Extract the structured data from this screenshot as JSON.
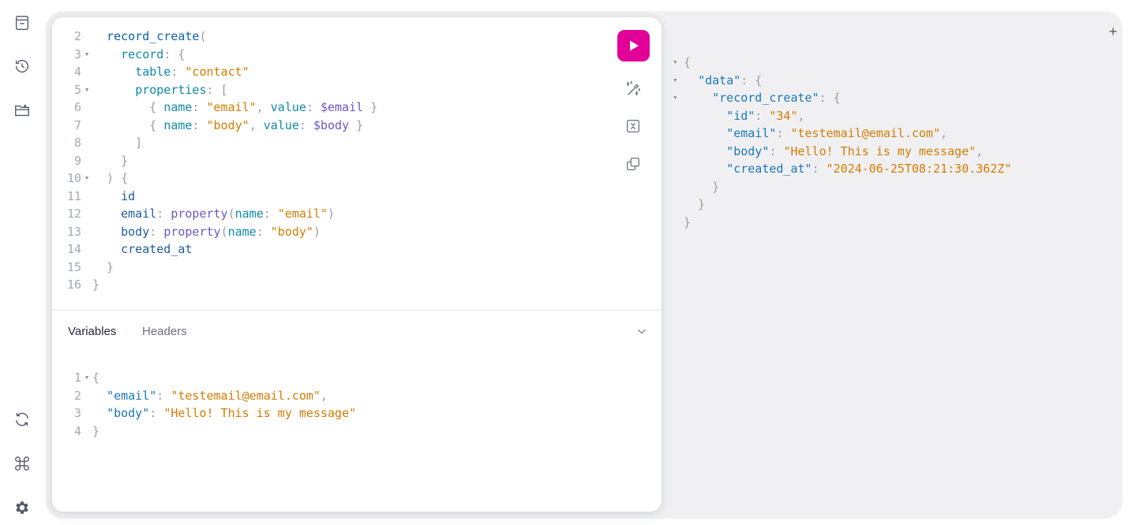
{
  "sidebar": {
    "top_icons": [
      "docs-icon",
      "history-icon",
      "explorer-icon"
    ],
    "bottom_icons": [
      "refetch-icon",
      "shortcuts-icon",
      "settings-icon"
    ]
  },
  "query_editor": {
    "lines": [
      {
        "n": "2",
        "fold": false,
        "t": [
          [
            "  ",
            "p"
          ],
          [
            "record_create",
            "f"
          ],
          [
            "(",
            "p"
          ]
        ]
      },
      {
        "n": "3",
        "fold": true,
        "t": [
          [
            "    ",
            "p"
          ],
          [
            "record",
            "a"
          ],
          [
            ": {",
            "p"
          ]
        ]
      },
      {
        "n": "4",
        "fold": false,
        "t": [
          [
            "      ",
            "p"
          ],
          [
            "table",
            "a"
          ],
          [
            ": ",
            "p"
          ],
          [
            "\"contact\"",
            "s"
          ]
        ]
      },
      {
        "n": "5",
        "fold": true,
        "t": [
          [
            "      ",
            "p"
          ],
          [
            "properties",
            "a"
          ],
          [
            ": [",
            "p"
          ]
        ]
      },
      {
        "n": "6",
        "fold": false,
        "t": [
          [
            "        { ",
            "p"
          ],
          [
            "name",
            "a"
          ],
          [
            ": ",
            "p"
          ],
          [
            "\"email\"",
            "s"
          ],
          [
            ", ",
            "p"
          ],
          [
            "value",
            "a"
          ],
          [
            ": ",
            "p"
          ],
          [
            "$email",
            "v"
          ],
          [
            " }",
            "p"
          ]
        ]
      },
      {
        "n": "7",
        "fold": false,
        "t": [
          [
            "        { ",
            "p"
          ],
          [
            "name",
            "a"
          ],
          [
            ": ",
            "p"
          ],
          [
            "\"body\"",
            "s"
          ],
          [
            ", ",
            "p"
          ],
          [
            "value",
            "a"
          ],
          [
            ": ",
            "p"
          ],
          [
            "$body",
            "v"
          ],
          [
            " }",
            "p"
          ]
        ]
      },
      {
        "n": "8",
        "fold": false,
        "t": [
          [
            "      ]",
            "p"
          ]
        ]
      },
      {
        "n": "9",
        "fold": false,
        "t": [
          [
            "    }",
            "p"
          ]
        ]
      },
      {
        "n": "10",
        "fold": true,
        "t": [
          [
            "  ) {",
            "p"
          ]
        ]
      },
      {
        "n": "11",
        "fold": false,
        "t": [
          [
            "    ",
            "p"
          ],
          [
            "id",
            "d"
          ]
        ]
      },
      {
        "n": "12",
        "fold": false,
        "t": [
          [
            "    ",
            "p"
          ],
          [
            "email",
            "d"
          ],
          [
            ": ",
            "p"
          ],
          [
            "property",
            "v"
          ],
          [
            "(",
            "p"
          ],
          [
            "name",
            "a"
          ],
          [
            ": ",
            "p"
          ],
          [
            "\"email\"",
            "s"
          ],
          [
            ")",
            "p"
          ]
        ]
      },
      {
        "n": "13",
        "fold": false,
        "t": [
          [
            "    ",
            "p"
          ],
          [
            "body",
            "d"
          ],
          [
            ": ",
            "p"
          ],
          [
            "property",
            "v"
          ],
          [
            "(",
            "p"
          ],
          [
            "name",
            "a"
          ],
          [
            ": ",
            "p"
          ],
          [
            "\"body\"",
            "s"
          ],
          [
            ")",
            "p"
          ]
        ]
      },
      {
        "n": "14",
        "fold": false,
        "t": [
          [
            "    ",
            "p"
          ],
          [
            "created_at",
            "d"
          ]
        ]
      },
      {
        "n": "15",
        "fold": false,
        "t": [
          [
            "  }",
            "p"
          ]
        ]
      },
      {
        "n": "16",
        "fold": false,
        "t": [
          [
            "}",
            "p"
          ]
        ]
      }
    ]
  },
  "toolbar": {
    "run_icon": "play-icon",
    "tools": [
      "prettify-icon",
      "merge-fragments-icon",
      "copy-icon"
    ]
  },
  "bottom_panel": {
    "tabs": {
      "variables": "Variables",
      "headers": "Headers"
    },
    "collapse_icon": "chevron-down-icon",
    "lines": [
      {
        "n": "1",
        "fold": true,
        "t": [
          [
            "{",
            "p"
          ]
        ]
      },
      {
        "n": "2",
        "fold": false,
        "t": [
          [
            "  ",
            "p"
          ],
          [
            "\"email\"",
            "k"
          ],
          [
            ": ",
            "p"
          ],
          [
            "\"testemail@email.com\"",
            "s"
          ],
          [
            ",",
            "p"
          ]
        ]
      },
      {
        "n": "3",
        "fold": false,
        "t": [
          [
            "  ",
            "p"
          ],
          [
            "\"body\"",
            "k"
          ],
          [
            ": ",
            "p"
          ],
          [
            "\"Hello! This is my message\"",
            "s"
          ]
        ]
      },
      {
        "n": "4",
        "fold": false,
        "t": [
          [
            "}",
            "p"
          ]
        ]
      }
    ]
  },
  "new_tab": {
    "label": "+"
  },
  "response": {
    "lines": [
      {
        "fold": true,
        "t": [
          [
            "{",
            "p"
          ]
        ]
      },
      {
        "fold": true,
        "t": [
          [
            "  ",
            "p"
          ],
          [
            "\"data\"",
            "k"
          ],
          [
            ": {",
            "p"
          ]
        ]
      },
      {
        "fold": true,
        "t": [
          [
            "    ",
            "p"
          ],
          [
            "\"record_create\"",
            "k"
          ],
          [
            ": {",
            "p"
          ]
        ]
      },
      {
        "fold": false,
        "t": [
          [
            "      ",
            "p"
          ],
          [
            "\"id\"",
            "k"
          ],
          [
            ": ",
            "p"
          ],
          [
            "\"34\"",
            "s"
          ],
          [
            ",",
            "p"
          ]
        ]
      },
      {
        "fold": false,
        "t": [
          [
            "      ",
            "p"
          ],
          [
            "\"email\"",
            "k"
          ],
          [
            ": ",
            "p"
          ],
          [
            "\"testemail@email.com\"",
            "s"
          ],
          [
            ",",
            "p"
          ]
        ]
      },
      {
        "fold": false,
        "t": [
          [
            "      ",
            "p"
          ],
          [
            "\"body\"",
            "k"
          ],
          [
            ": ",
            "p"
          ],
          [
            "\"Hello! This is my message\"",
            "s"
          ],
          [
            ",",
            "p"
          ]
        ]
      },
      {
        "fold": false,
        "t": [
          [
            "      ",
            "p"
          ],
          [
            "\"created_at\"",
            "k"
          ],
          [
            ": ",
            "p"
          ],
          [
            "\"2024-06-25T08:21:30.362Z\"",
            "s"
          ]
        ]
      },
      {
        "fold": false,
        "t": [
          [
            "    }",
            "p"
          ]
        ]
      },
      {
        "fold": false,
        "t": [
          [
            "  }",
            "p"
          ]
        ]
      },
      {
        "fold": false,
        "t": [
          [
            "}",
            "p"
          ]
        ]
      }
    ]
  },
  "colors": {
    "accent": "#e10098",
    "string": "#d47c00",
    "key": "#1a78b8",
    "variable": "#6e57c6",
    "function": "#0d62b0"
  }
}
